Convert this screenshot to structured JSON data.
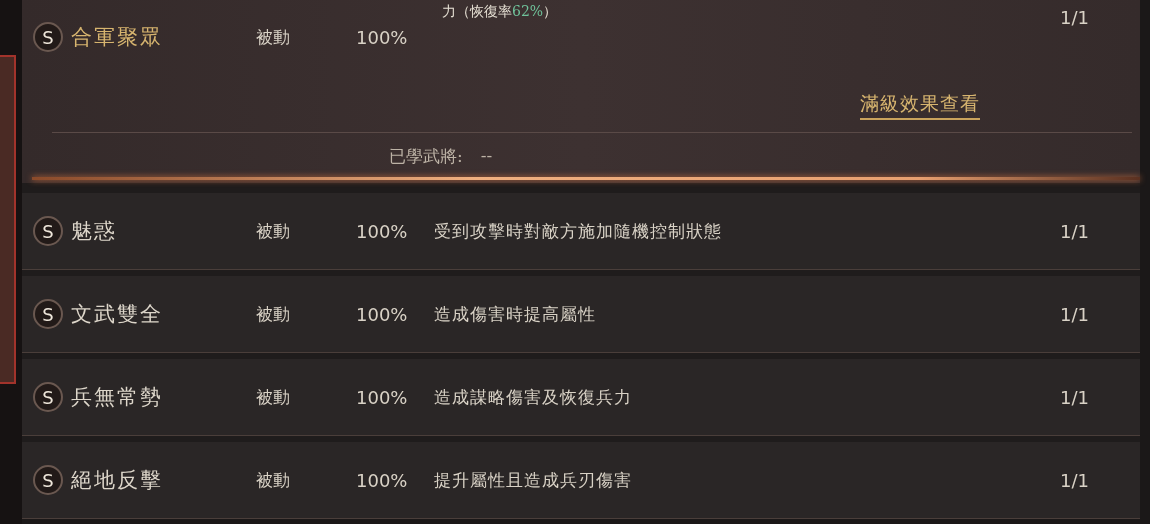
{
  "expanded_skill": {
    "grade": "S",
    "name": "合軍聚眾",
    "type": "被動",
    "rate": "100%",
    "description_tail": {
      "text": "力（恢復率",
      "highlight": "62%",
      "end": "）"
    },
    "level": "1/1",
    "detail_link": "滿級效果查看",
    "learned_label": "已學武將:",
    "learned_value": "--"
  },
  "skills": [
    {
      "grade": "S",
      "name": "魅惑",
      "type": "被動",
      "rate": "100%",
      "description": "受到攻擊時對敵方施加隨機控制狀態",
      "level": "1/1"
    },
    {
      "grade": "S",
      "name": "文武雙全",
      "type": "被動",
      "rate": "100%",
      "description": "造成傷害時提高屬性",
      "level": "1/1"
    },
    {
      "grade": "S",
      "name": "兵無常勢",
      "type": "被動",
      "rate": "100%",
      "description": "造成謀略傷害及恢復兵力",
      "level": "1/1"
    },
    {
      "grade": "S",
      "name": "絕地反擊",
      "type": "被動",
      "rate": "100%",
      "description": "提升屬性且造成兵刃傷害",
      "level": "1/1"
    }
  ]
}
